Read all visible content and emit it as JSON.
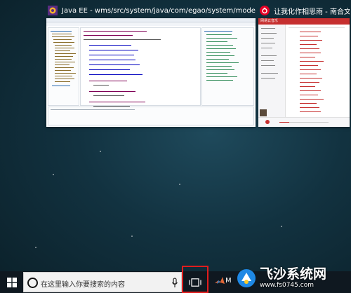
{
  "task_view": {
    "windows": [
      {
        "title": "Java EE - wms/src/system/java/com/egao/system/model/Author...",
        "icon": "eclipse-icon"
      },
      {
        "title": "让我化作相思雨 - 南合文斗",
        "icon": "netease-music-icon"
      }
    ]
  },
  "music": {
    "brand": "网易云音乐"
  },
  "taskbar": {
    "search_placeholder": "在这里输入你要搜索的内容",
    "pinned_label": "M",
    "icons": [
      "windows-start-icon",
      "cortana-icon",
      "microphone-icon",
      "task-view-icon",
      "matlab-icon"
    ]
  },
  "watermark": {
    "title": "飞沙系统网",
    "url": "www.fs0745.com"
  },
  "colors": {
    "highlight": "#e11d1d",
    "music_red": "#c62f2f",
    "taskbar": "#0f1820"
  }
}
